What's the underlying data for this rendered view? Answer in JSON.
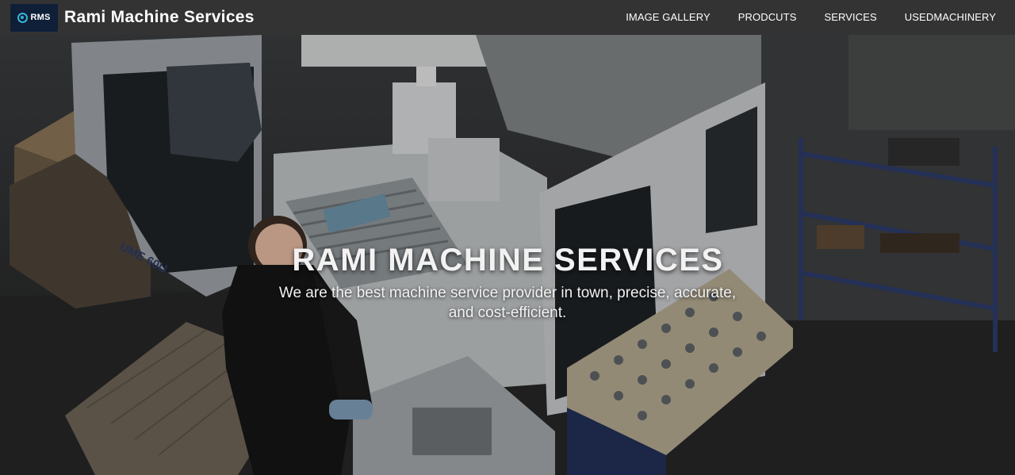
{
  "brand": {
    "logo_text": "RMS",
    "logo_icon": "rms-ring-icon",
    "name": "Rami Machine Services",
    "logo_accent": "#35b6d8",
    "logo_bg": "#0f1f38"
  },
  "nav": {
    "background": "#333333",
    "links": [
      {
        "label": "IMAGE GALLERY"
      },
      {
        "label": "PRODCUTS"
      },
      {
        "label": "SERVICES"
      },
      {
        "label": "USEDMACHINERY"
      }
    ]
  },
  "hero": {
    "title": "RAMI MACHINE SERVICES",
    "subtitle": "We are the best machine service provider in town, precise, accurate, and cost-efficient.",
    "machine_label": "UME 60U"
  }
}
